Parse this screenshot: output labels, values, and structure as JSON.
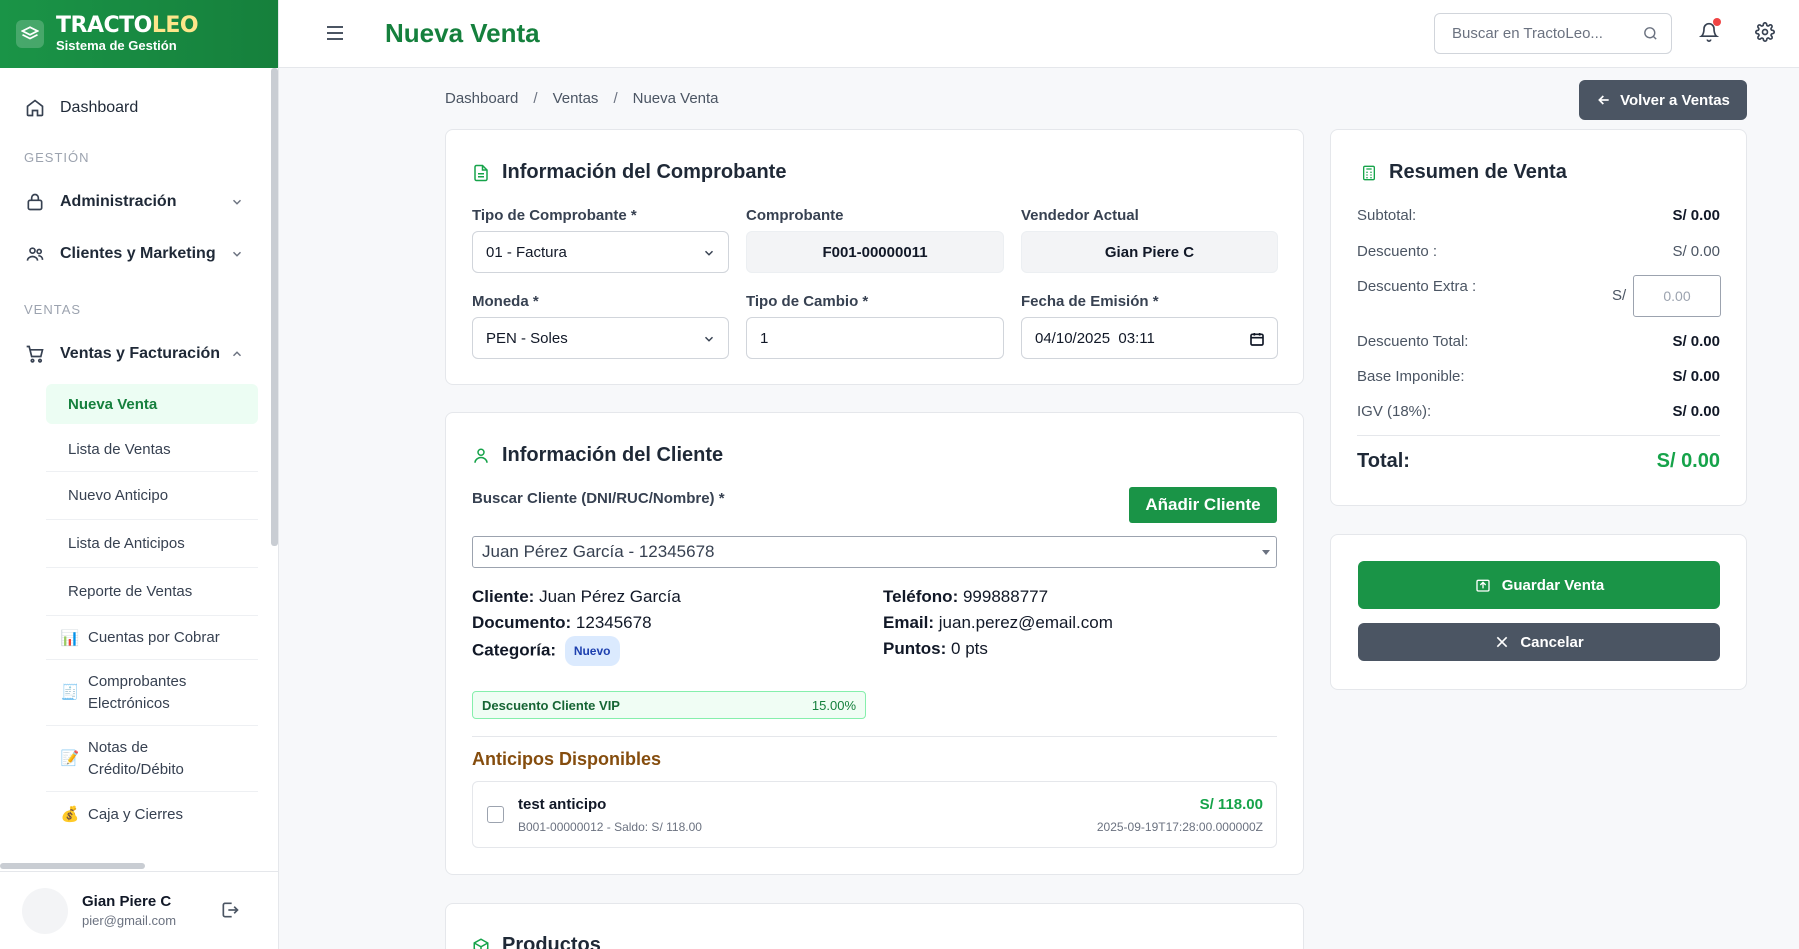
{
  "brand": {
    "name_a": "TRACTO",
    "name_b": "LEO",
    "subtitle": "Sistema de Gestión"
  },
  "sidebar": {
    "dashboard": "Dashboard",
    "section_gestion": "GESTIÓN",
    "administracion": "Administración",
    "clientes_marketing": "Clientes y Marketing",
    "section_ventas": "VENTAS",
    "ventas_facturacion": "Ventas y Facturación",
    "sub": [
      {
        "label": "Nueva Venta"
      },
      {
        "label": "Lista de Ventas"
      },
      {
        "label": "Nuevo Anticipo"
      },
      {
        "label": "Lista de Anticipos"
      },
      {
        "label": "Reporte de Ventas"
      },
      {
        "label": "Cuentas por Cobrar",
        "icon": "📊"
      },
      {
        "label": "Comprobantes Electrónicos",
        "icon": "🧾"
      },
      {
        "label": "Notas de Crédito/Débito",
        "icon": "📝"
      },
      {
        "label": "Caja y Cierres",
        "icon": "💰"
      }
    ],
    "user": {
      "name": "Gian Piere C",
      "email": "pier@gmail.com"
    }
  },
  "topbar": {
    "title": "Nueva Venta",
    "search_placeholder": "Buscar en TractoLeo..."
  },
  "breadcrumb": [
    "Dashboard",
    "Ventas",
    "Nueva Venta"
  ],
  "back_button": "Volver a Ventas",
  "comprobante": {
    "title": "Información del Comprobante",
    "tipo_label": "Tipo de Comprobante *",
    "tipo_value": "01 - Factura",
    "comprobante_label": "Comprobante",
    "comprobante_value": "F001-00000011",
    "vendedor_label": "Vendedor Actual",
    "vendedor_value": "Gian Piere C",
    "moneda_label": "Moneda *",
    "moneda_value": "PEN - Soles",
    "cambio_label": "Tipo de Cambio *",
    "cambio_value": "1",
    "fecha_label": "Fecha de Emisión *",
    "fecha_value": "04/10/2025  03:11"
  },
  "cliente": {
    "title": "Información del Cliente",
    "buscar_label": "Buscar Cliente (DNI/RUC/Nombre) *",
    "add_button": "Añadir Cliente",
    "selected": "Juan Pérez García - 12345678",
    "cliente_k": "Cliente:",
    "cliente_v": "Juan Pérez García",
    "documento_k": "Documento:",
    "documento_v": "12345678",
    "categoria_k": "Categoría:",
    "categoria_v": "Nuevo",
    "telefono_k": "Teléfono:",
    "telefono_v": "999888777",
    "email_k": "Email:",
    "email_v": "juan.perez@email.com",
    "puntos_k": "Puntos:",
    "puntos_v": "0 pts",
    "vip_label": "Descuento Cliente VIP",
    "vip_pct": "15.00%",
    "anticipos_title": "Anticipos Disponibles",
    "anticipo": {
      "name": "test anticipo",
      "meta": "B001-00000012 - Saldo: S/ 118.00",
      "amount": "S/ 118.00",
      "date": "2025-09-19T17:28:00.000000Z"
    }
  },
  "productos_title": "Productos",
  "resumen": {
    "title": "Resumen de Venta",
    "subtotal_k": "Subtotal:",
    "subtotal_v": "S/ 0.00",
    "descuento_k": "Descuento :",
    "descuento_v": "S/ 0.00",
    "extra_k": "Descuento Extra :",
    "extra_sym": "S/",
    "extra_placeholder": "0.00",
    "desc_total_k": "Descuento Total:",
    "desc_total_v": "S/ 0.00",
    "base_k": "Base Imponible:",
    "base_v": "S/ 0.00",
    "igv_k": "IGV (18%):",
    "igv_v": "S/ 0.00",
    "total_k": "Total:",
    "total_v": "S/ 0.00"
  },
  "actions": {
    "save": "Guardar Venta",
    "cancel": "Cancelar"
  },
  "colors": {
    "brand_green": "#1a9447",
    "dark_gray": "#4b5563",
    "accent_green": "#15803d"
  }
}
